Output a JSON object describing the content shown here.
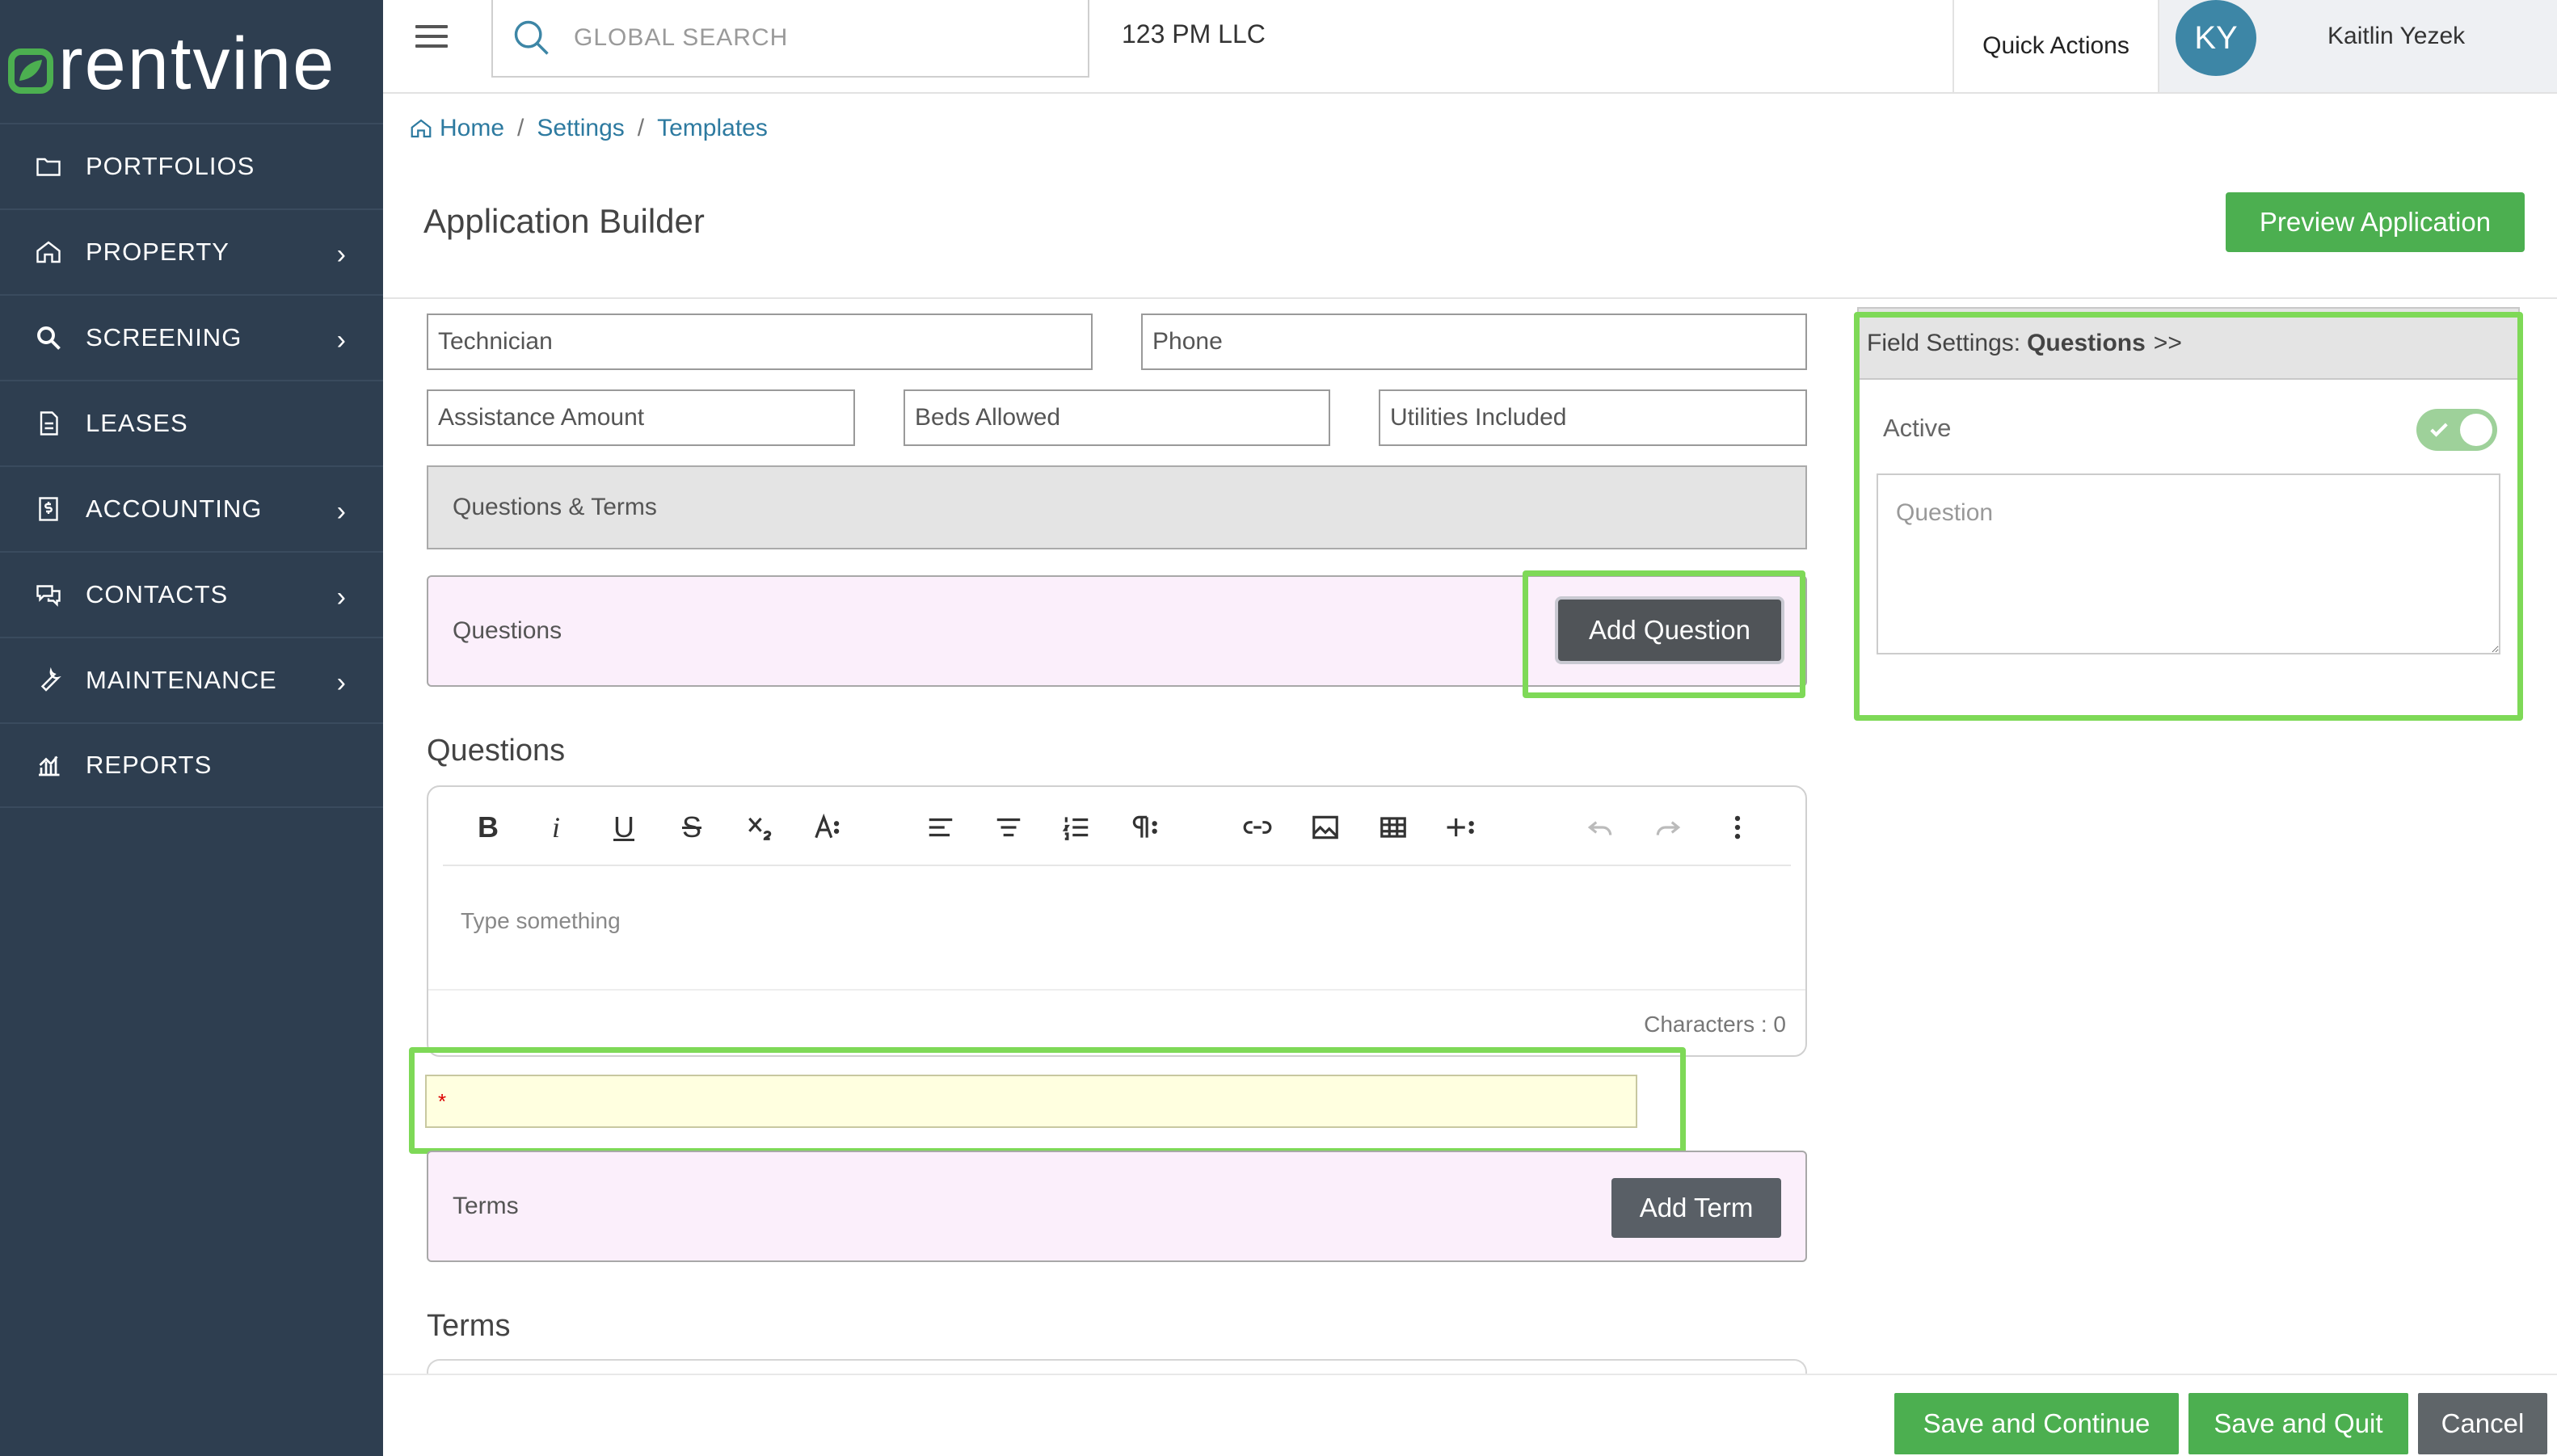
{
  "brand": {
    "name": "rentvine",
    "accent": "#4caf50",
    "sidebar_bg": "#2e3e50",
    "highlight": "#7ed957"
  },
  "sidebar": {
    "items": [
      {
        "label": "PORTFOLIOS",
        "icon": "folder-icon",
        "has_chevron": false
      },
      {
        "label": "PROPERTY",
        "icon": "home-icon",
        "has_chevron": true
      },
      {
        "label": "SCREENING",
        "icon": "magnifier-icon",
        "has_chevron": true
      },
      {
        "label": "LEASES",
        "icon": "document-icon",
        "has_chevron": false
      },
      {
        "label": "ACCOUNTING",
        "icon": "dollar-icon",
        "has_chevron": true
      },
      {
        "label": "CONTACTS",
        "icon": "chat-icon",
        "has_chevron": true
      },
      {
        "label": "MAINTENANCE",
        "icon": "wrench-icon",
        "has_chevron": true
      },
      {
        "label": "REPORTS",
        "icon": "chart-icon",
        "has_chevron": false
      }
    ],
    "chevron": "›"
  },
  "topbar": {
    "search_placeholder": "GLOBAL SEARCH",
    "company": "123 PM LLC",
    "quick_actions": "Quick Actions",
    "avatar_initials": "KY",
    "user_name": "Kaitlin Yezek"
  },
  "breadcrumb": {
    "items": [
      "Home",
      "Settings",
      "Templates"
    ],
    "separator": "/"
  },
  "page": {
    "title": "Application Builder",
    "preview_button": "Preview Application"
  },
  "form": {
    "row1": [
      "Technician",
      "Phone"
    ],
    "row2": [
      "Assistance Amount",
      "Beds Allowed",
      "Utilities Included"
    ],
    "section_label": "Questions & Terms",
    "questions_box_label": "Questions",
    "add_question": "Add Question",
    "questions_heading": "Questions",
    "editor_placeholder": "Type something",
    "characters_label": "Characters : 0",
    "required_marker": "*",
    "terms_box_label": "Terms",
    "add_term": "Add Term",
    "terms_heading": "Terms"
  },
  "field_settings": {
    "label": "Field Settings:",
    "field": "Questions",
    "arrow": ">>",
    "active_label": "Active",
    "active": true,
    "question_placeholder": "Question"
  },
  "footer": {
    "save_continue": "Save and Continue",
    "save_quit": "Save and Quit",
    "cancel": "Cancel"
  }
}
